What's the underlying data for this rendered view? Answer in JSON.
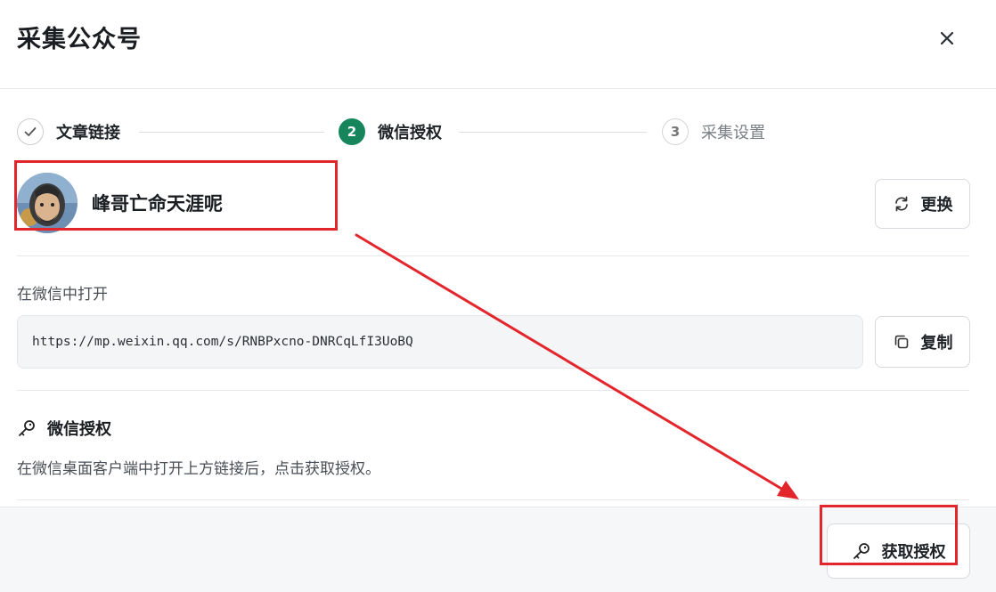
{
  "dialog": {
    "title": "采集公众号"
  },
  "steps": [
    {
      "label": "文章链接",
      "number": "",
      "state": "done"
    },
    {
      "label": "微信授权",
      "number": "2",
      "state": "active"
    },
    {
      "label": "采集设置",
      "number": "3",
      "state": "pending"
    }
  ],
  "account": {
    "name": "峰哥亡命天涯呢",
    "change_label": "更换"
  },
  "open_link": {
    "label": "在微信中打开",
    "url": "https://mp.weixin.qq.com/s/RNBPxcno-DNRCqLfI3UoBQ",
    "copy_label": "复制"
  },
  "auth": {
    "title": "微信授权",
    "description": "在微信桌面客户端中打开上方链接后，点击获取授权。",
    "get_button_label": "获取授权"
  },
  "colors": {
    "accent": "#16855c",
    "annotation": "#e3262c"
  }
}
